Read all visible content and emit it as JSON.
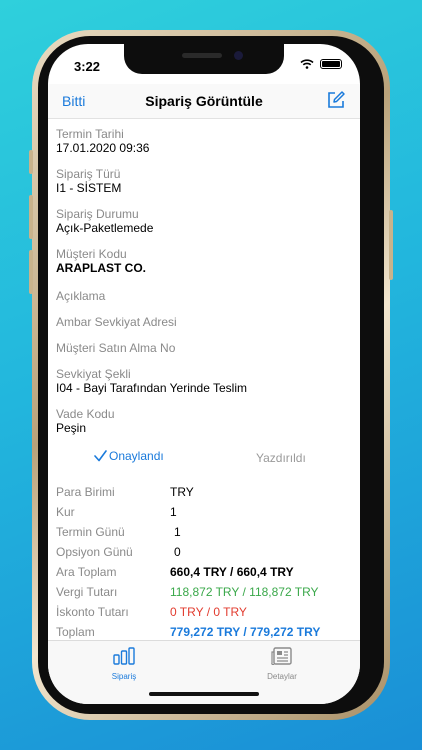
{
  "status": {
    "time": "3:22"
  },
  "navbar": {
    "back_label": "Bitti",
    "title": "Sipariş Görüntüle",
    "edit_icon": "compose-icon"
  },
  "fields": [
    {
      "label": "Termin Tarihi",
      "value": "17.01.2020 09:36",
      "bold": false
    },
    {
      "label": "Sipariş Türü",
      "value": "I1 - SİSTEM",
      "bold": false
    },
    {
      "label": "Sipariş Durumu",
      "value": "Açık-Paketlemede",
      "bold": false
    },
    {
      "label": "Müşteri Kodu",
      "value": "ARAPLAST CO.",
      "bold": true
    },
    {
      "label": "Açıklama",
      "value": ""
    },
    {
      "label": "Ambar Sevkiyat Adresi",
      "value": ""
    },
    {
      "label": "Müşteri Satın Alma No",
      "value": ""
    },
    {
      "label": "Sevkiyat Şekli",
      "value": "I04 - Bayi Tarafından Yerinde Teslim",
      "bold": false
    },
    {
      "label": "Vade Kodu",
      "value": "Peşin",
      "bold": false
    }
  ],
  "approval": {
    "approved_label": "Onaylandı",
    "printed_label": "Yazdırıldı"
  },
  "summary": [
    {
      "label": "Para Birimi",
      "value": "TRY"
    },
    {
      "label": "Kur",
      "value": "1"
    },
    {
      "label": "Termin Günü",
      "value": "1"
    },
    {
      "label": "Opsiyon Günü",
      "value": "0"
    },
    {
      "label": "Ara Toplam",
      "value": "660,4 TRY / 660,4 TRY"
    },
    {
      "label": "Vergi Tutarı",
      "value": "118,872 TRY / 118,872 TRY"
    },
    {
      "label": "İskonto Tutarı",
      "value": "0 TRY / 0 TRY"
    },
    {
      "label": "Toplam",
      "value": "779,272 TRY / 779,272 TRY"
    }
  ],
  "tabs": [
    {
      "label": "Sipariş",
      "icon": "bar-chart-icon",
      "active": true
    },
    {
      "label": "Detaylar",
      "icon": "document-icon",
      "active": false
    }
  ],
  "colors": {
    "accent": "#1a7adb",
    "positive": "#3aa84a",
    "negative": "#e23b2e"
  }
}
